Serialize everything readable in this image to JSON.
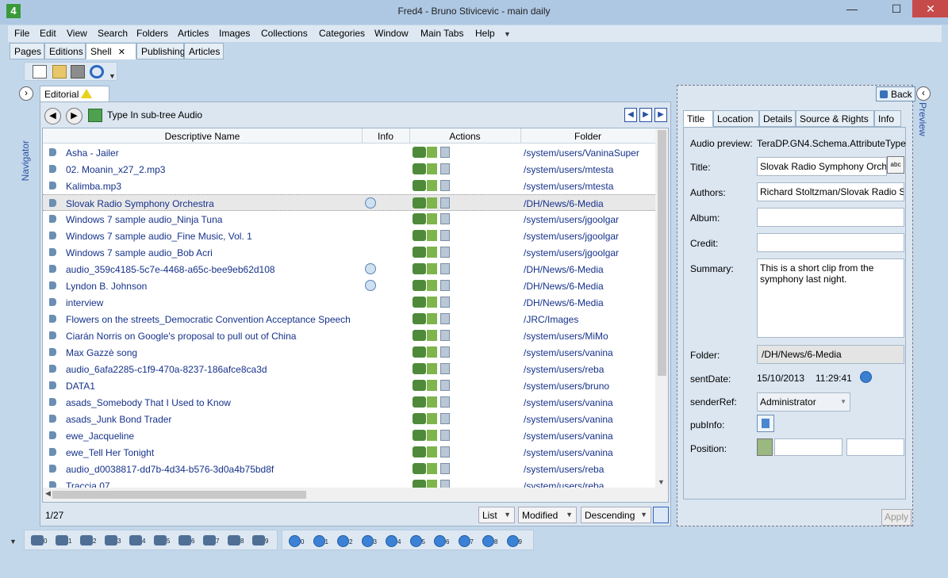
{
  "window": {
    "title": "Fred4 - Bruno Stivicevic - main daily",
    "app_icon": "4"
  },
  "menu": [
    "File",
    "Edit",
    "View",
    "Search",
    "Folders",
    "Articles",
    "Images",
    "Collections",
    "Categories",
    "Window",
    "Main Tabs",
    "Help"
  ],
  "main_tabs": [
    "Pages",
    "Editions",
    "Shell",
    "Publishing",
    "Articles"
  ],
  "navigator_label": "Navigator",
  "preview_label": "Preview",
  "editorial": {
    "tab_label": "Editorial",
    "subtree_label": "Type In sub-tree Audio",
    "columns": [
      "Descriptive Name",
      "Info",
      "Actions",
      "Folder"
    ],
    "rows": [
      {
        "name": "Asha - Jailer",
        "folder": "/system/users/VaninaSuper",
        "info": false
      },
      {
        "name": "02. Moanin_x27_2.mp3",
        "folder": "/system/users/mtesta",
        "info": false
      },
      {
        "name": "Kalimba.mp3",
        "folder": "/system/users/mtesta",
        "info": false
      },
      {
        "name": "Slovak Radio Symphony Orchestra",
        "folder": "/DH/News/6-Media",
        "info": true
      },
      {
        "name": "Windows 7 sample audio_Ninja Tuna",
        "folder": "/system/users/jgoolgar",
        "info": false
      },
      {
        "name": "Windows 7 sample audio_Fine Music, Vol. 1",
        "folder": "/system/users/jgoolgar",
        "info": false
      },
      {
        "name": "Windows 7 sample audio_Bob Acri",
        "folder": "/system/users/jgoolgar",
        "info": false
      },
      {
        "name": "audio_359c4185-5c7e-4468-a65c-bee9eb62d108",
        "folder": "/DH/News/6-Media",
        "info": true
      },
      {
        "name": "Lyndon B. Johnson",
        "folder": "/DH/News/6-Media",
        "info": true
      },
      {
        "name": "interview",
        "folder": "/DH/News/6-Media",
        "info": false
      },
      {
        "name": "Flowers on the streets_Democratic Convention Acceptance Speech",
        "folder": "/JRC/Images",
        "info": false
      },
      {
        "name": "Ciarán Norris on Google's proposal to pull out of China",
        "folder": "/system/users/MiMo",
        "info": false
      },
      {
        "name": "Max Gazzè song",
        "folder": "/system/users/vanina",
        "info": false
      },
      {
        "name": "audio_6afa2285-c1f9-470a-8237-186afce8ca3d",
        "folder": "/system/users/reba",
        "info": false
      },
      {
        "name": "DATA1",
        "folder": "/system/users/bruno",
        "info": false
      },
      {
        "name": "asads_Somebody That I Used to Know",
        "folder": "/system/users/vanina",
        "info": false
      },
      {
        "name": "asads_Junk Bond Trader",
        "folder": "/system/users/vanina",
        "info": false
      },
      {
        "name": "ewe_Jacqueline",
        "folder": "/system/users/vanina",
        "info": false
      },
      {
        "name": "ewe_Tell Her Tonight",
        "folder": "/system/users/vanina",
        "info": false
      },
      {
        "name": "audio_d0038817-dd7b-4d34-b576-3d0a4b75bd8f",
        "folder": "/system/users/reba",
        "info": false
      },
      {
        "name": "Traccia 07",
        "folder": "/system/users/reba",
        "info": false
      }
    ],
    "selected_row": 3,
    "count": "1/27",
    "view_mode": "List",
    "sort_field": "Modified",
    "sort_order": "Descending"
  },
  "detail": {
    "back_label": "Back",
    "tabs": [
      "Title",
      "Location",
      "Details",
      "Source & Rights",
      "Info"
    ],
    "labels": {
      "audio_preview": "Audio preview:",
      "title": "Title:",
      "authors": "Authors:",
      "album": "Album:",
      "credit": "Credit:",
      "summary": "Summary:",
      "folder": "Folder:",
      "sent_date": "sentDate:",
      "sender_ref": "senderRef:",
      "pub_info": "pubInfo:",
      "position": "Position:"
    },
    "values": {
      "audio_preview": "TeraDP.GN4.Schema.AttributeType",
      "title": "Slovak Radio Symphony Orchestra",
      "authors": "Richard Stoltzman/Slovak Radio Symphony",
      "album": "",
      "credit": "",
      "summary": "This is a short clip from the symphony last night.",
      "folder": "/DH/News/6-Media",
      "sent_date": "15/10/2013",
      "sent_time": "11:29:41",
      "sender_ref": "Administrator"
    },
    "spell_label": "abc",
    "apply_label": "Apply"
  },
  "bins": [
    "0",
    "1",
    "2",
    "3",
    "4",
    "5",
    "6",
    "7",
    "8",
    "9"
  ],
  "globes": [
    "0",
    "1",
    "2",
    "3",
    "4",
    "5",
    "6",
    "7",
    "8",
    "9"
  ]
}
